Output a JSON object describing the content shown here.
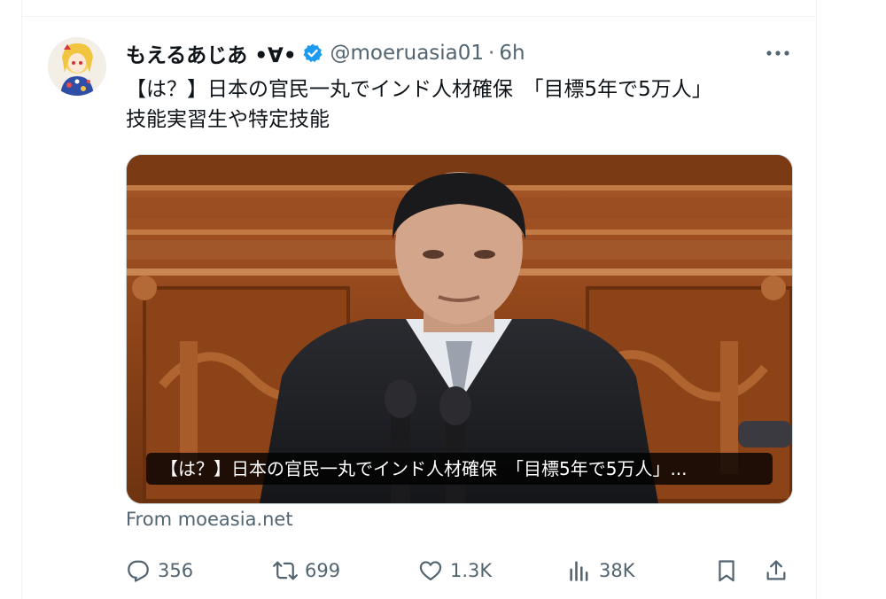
{
  "tweet": {
    "display_name": "もえるあじあ •∀•",
    "handle": "@moeruasia01",
    "separator": "·",
    "time": "6h",
    "text_line1": "【は？】日本の官民一丸でインド人材確保　「目標5年で5万人」",
    "text_line2": "技能実習生や特定技能",
    "media": {
      "caption": "【は？】日本の官民一丸でインド人材確保　「目標5年で5万人」..."
    },
    "source": "From moeasia.net",
    "metrics": {
      "replies": "356",
      "reposts": "699",
      "likes": "1.3K",
      "views": "38K"
    }
  },
  "icons": {
    "verified": "verified-badge-icon",
    "more": "more-icon",
    "reply": "reply-icon",
    "repost": "repost-icon",
    "like": "heart-icon",
    "views": "views-chart-icon",
    "bookmark": "bookmark-icon",
    "share": "share-icon"
  },
  "colors": {
    "verified": "#1d9bf0",
    "secondary_text": "#536471",
    "primary_text": "#0f1419"
  }
}
